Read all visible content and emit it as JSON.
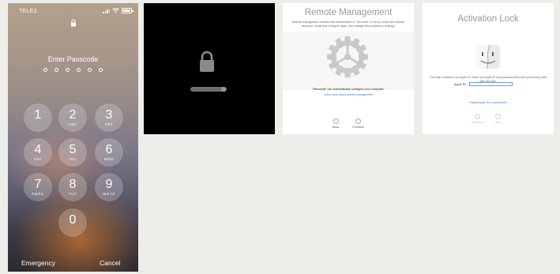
{
  "lockscreen": {
    "carrier": "TELE2",
    "prompt": "Enter Passcode",
    "keys": [
      {
        "digit": "1",
        "letters": ""
      },
      {
        "digit": "2",
        "letters": "ABC"
      },
      {
        "digit": "3",
        "letters": "DEF"
      },
      {
        "digit": "4",
        "letters": "GHI"
      },
      {
        "digit": "5",
        "letters": "JKL"
      },
      {
        "digit": "6",
        "letters": "MNO"
      },
      {
        "digit": "7",
        "letters": "PQRS"
      },
      {
        "digit": "8",
        "letters": "TUV"
      },
      {
        "digit": "9",
        "letters": "WXYZ"
      },
      {
        "digit": "0",
        "letters": ""
      }
    ],
    "emergency_label": "Emergency",
    "cancel_label": "Cancel"
  },
  "black_lock": {
    "icon": "lock-icon",
    "bar_color": "#6e6e6e"
  },
  "remote_management": {
    "title": "Remote Management",
    "description": "Remote management enables the administrator of \"Microsoft\" to set up email and network accounts, install and configure apps, and manage this computer's settings.",
    "statement": "\"Microsoft\" can automatically configure your computer.",
    "learn_more": "Learn more about remote management",
    "back_label": "Back",
    "continue_label": "Continue",
    "icon": "gear-icon"
  },
  "activation_lock": {
    "title": "Activation Lock",
    "description": "This Mac is linked to an Apple ID. Enter the Apple ID and password that were previously used with this Mac.",
    "apple_id_label": "Apple ID:",
    "apple_id_value": "",
    "forgot_link": "Forgot Apple ID or password?",
    "back_label": "Previous",
    "continue_label": "Next",
    "icon": "finder-icon",
    "link_color": "#3a7bd5"
  }
}
